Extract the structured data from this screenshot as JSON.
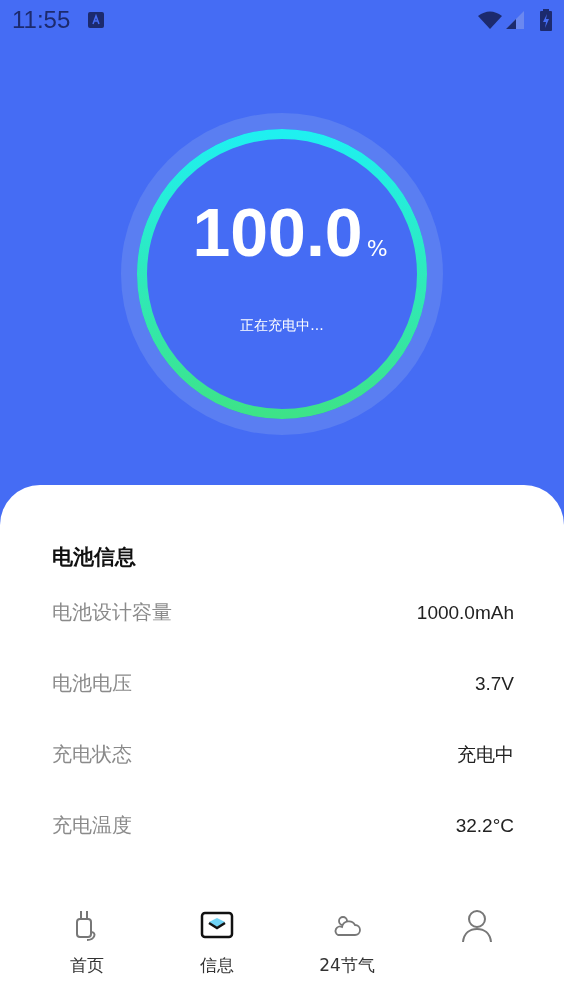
{
  "status_bar": {
    "time": "11:55"
  },
  "battery": {
    "level": 1.0,
    "percent": "100.0",
    "unit": "%",
    "status": "正在充电中..."
  },
  "info": {
    "title": "电池信息",
    "rows": [
      {
        "label": "电池设计容量",
        "value": "1000.0mAh"
      },
      {
        "label": "电池电压",
        "value": "3.7V"
      },
      {
        "label": "充电状态",
        "value": "充电中"
      },
      {
        "label": "充电温度",
        "value": "32.2°C"
      }
    ]
  },
  "nav": [
    {
      "kind": "plug",
      "label": "首页",
      "selected": false
    },
    {
      "kind": "mail",
      "label": "信息",
      "selected": true
    },
    {
      "kind": "weather",
      "label": "24节气",
      "selected": false
    },
    {
      "kind": "person",
      "selected": false
    }
  ]
}
